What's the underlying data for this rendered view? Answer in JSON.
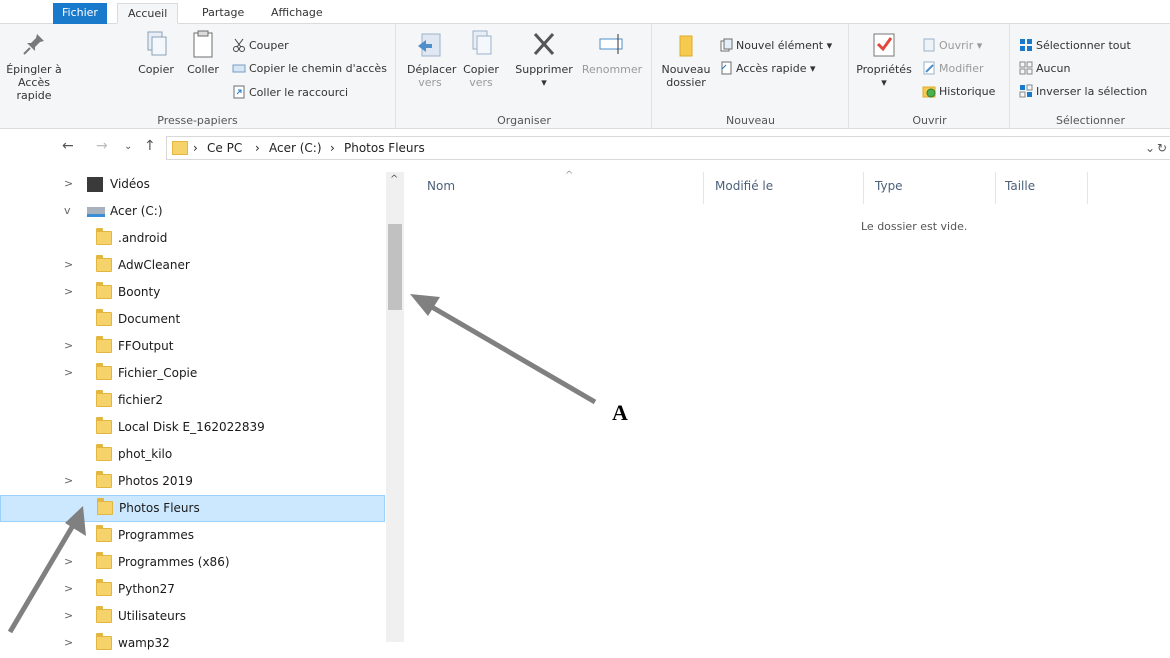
{
  "ribbon": {
    "tabs": [
      "Fichier",
      "Accueil",
      "Partage",
      "Affichage"
    ],
    "clipboard": {
      "pin": "Épingler à Accès rapide",
      "pin_l1": "Épingler à",
      "pin_l2": "Accès rapide",
      "copy": "Copier",
      "paste": "Coller",
      "cut": "Couper",
      "copy_path": "Copier le chemin d'accès",
      "paste_shortcut": "Coller le raccourci",
      "label": "Presse-papiers"
    },
    "organize": {
      "move_l1": "Déplacer",
      "move_l2": "vers",
      "copy_l1": "Copier",
      "copy_l2": "vers",
      "delete": "Supprimer",
      "rename": "Renommer",
      "label": "Organiser"
    },
    "new": {
      "folder_l1": "Nouveau",
      "folder_l2": "dossier",
      "new_item": "Nouvel élément",
      "quick_access": "Accès rapide",
      "label": "Nouveau"
    },
    "open": {
      "properties": "Propriétés",
      "open": "Ouvrir",
      "modify": "Modifier",
      "history": "Historique",
      "label": "Ouvrir"
    },
    "select": {
      "select_all": "Sélectionner tout",
      "none": "Aucun",
      "invert": "Inverser la sélection",
      "label": "Sélectionner"
    }
  },
  "address": {
    "crumbs": [
      "Ce PC",
      "Acer (C:)",
      "Photos Fleurs"
    ]
  },
  "nav": {
    "items": [
      {
        "label": "Vidéos",
        "chev": ">"
      },
      {
        "label": "Acer (C:)",
        "chev": "v"
      },
      {
        "label": ".android",
        "chev": ""
      },
      {
        "label": "AdwCleaner",
        "chev": ">"
      },
      {
        "label": "Boonty",
        "chev": ">"
      },
      {
        "label": "Document",
        "chev": ""
      },
      {
        "label": "FFOutput",
        "chev": ">"
      },
      {
        "label": "Fichier_Copie",
        "chev": ">"
      },
      {
        "label": "fichier2",
        "chev": ""
      },
      {
        "label": "Local Disk E_162022839",
        "chev": ""
      },
      {
        "label": "phot_kilo",
        "chev": ""
      },
      {
        "label": "Photos 2019",
        "chev": ">"
      },
      {
        "label": "Photos Fleurs",
        "chev": ""
      },
      {
        "label": "Programmes",
        "chev": ""
      },
      {
        "label": "Programmes (x86)",
        "chev": ">"
      },
      {
        "label": "Python27",
        "chev": ">"
      },
      {
        "label": "Utilisateurs",
        "chev": ">"
      },
      {
        "label": "wamp32",
        "chev": ">"
      }
    ]
  },
  "content": {
    "columns": [
      "Nom",
      "Modifié le",
      "Type",
      "Taille"
    ],
    "empty_text": "Le dossier est vide."
  },
  "annotation": {
    "label": "A"
  }
}
